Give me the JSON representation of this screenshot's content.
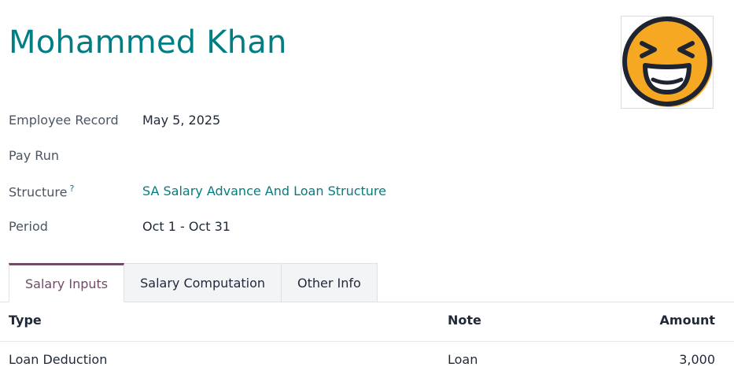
{
  "record": {
    "title": "Mohammed Khan",
    "avatar_icon": "laughing-emoji-icon"
  },
  "fields": [
    {
      "label": "Employee Record",
      "value": "May 5, 2025",
      "link": false,
      "help": false
    },
    {
      "label": "Pay Run",
      "value": "",
      "link": false,
      "help": false
    },
    {
      "label": "Structure",
      "value": "SA Salary Advance And Loan Structure",
      "link": true,
      "help": true
    },
    {
      "label": "Period",
      "value": "Oct 1 - Oct 31",
      "link": false,
      "help": false
    }
  ],
  "help_mark": "?",
  "tabs": [
    {
      "label": "Salary Inputs",
      "active": true
    },
    {
      "label": "Salary Computation",
      "active": false
    },
    {
      "label": "Other Info",
      "active": false
    }
  ],
  "table": {
    "columns": {
      "type": "Type",
      "note": "Note",
      "amount": "Amount"
    },
    "rows": [
      {
        "type": "Loan Deduction",
        "note": "Loan",
        "amount": "3,000"
      }
    ]
  },
  "colors": {
    "accent": "#017e84",
    "tab_active": "#714b67",
    "emoji_fill": "#f9a825"
  }
}
